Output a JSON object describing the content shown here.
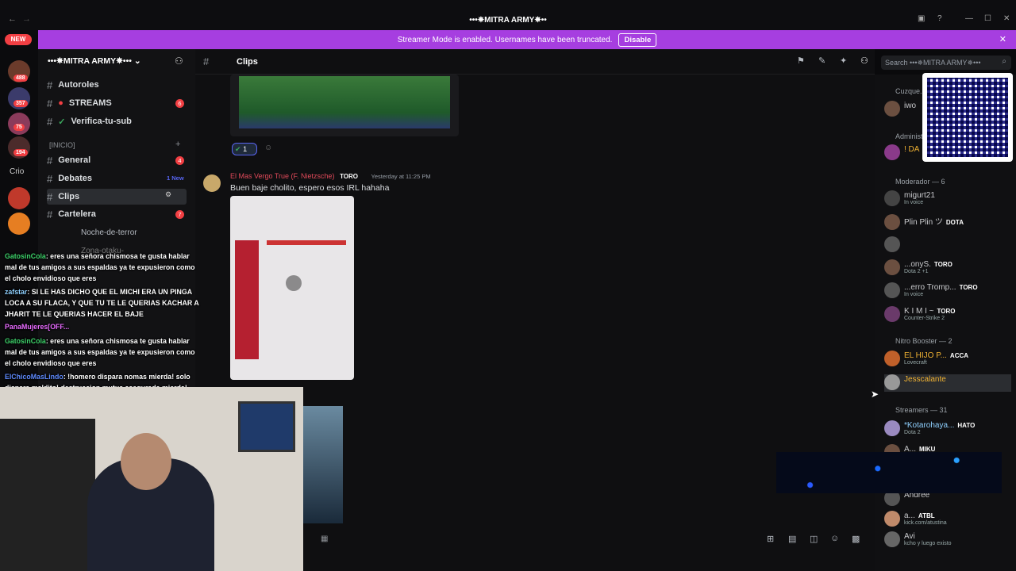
{
  "window": {
    "title": "•••✵MITRA ARMY✵••"
  },
  "banner": {
    "text": "Streamer Mode is enabled. Usernames have been truncated.",
    "button": "Disable"
  },
  "rail": {
    "new_label": "NEW",
    "pings": [
      "488",
      "357",
      "75",
      "194"
    ],
    "other": "Crio"
  },
  "server": {
    "name": "•••✵MITRA ARMY✵•••"
  },
  "channels": [
    {
      "name": "Autoroles",
      "badge": ""
    },
    {
      "name": "STREAMS",
      "badge": "6"
    },
    {
      "name": "Verifica-tu-sub",
      "badge": ""
    },
    {
      "name": "General",
      "badge": "4"
    },
    {
      "name": "Debates",
      "badge": "1 New"
    },
    {
      "name": "Clips",
      "badge": ""
    },
    {
      "name": "Cartelera",
      "badge": "7"
    },
    {
      "name": "Noche-de-terror",
      "badge": ""
    },
    {
      "name": "Zona-otaku-",
      "badge": ""
    }
  ],
  "category": "[INICIO]",
  "channel_header": {
    "name": "Clips",
    "search_placeholder": "Search •••✵MITRA ARMY✵•••"
  },
  "message": {
    "author": "El Mas Vergo True (F. Nietzsche)",
    "tag": "TORO",
    "time": "Yesterday at 11:25 PM",
    "text": "Buen baje cholito, espero esos IRL hahaha",
    "reaction_count": "1"
  },
  "chat_overlay": [
    {
      "user": "GatosinCola",
      "text": ": eres una señora chismosa te gusta hablar mal de tus amigos a sus espaldas ya te expusieron como el cholo envidioso que eres"
    },
    {
      "user": "zafstar",
      "text": ": SI LE HAS DICHO QUE EL MICHI ERA UN PINGA LOCA A SU FLACA, Y QUE TU TE LE QUERIAS KACHAR A JHARIT TE LE QUERIAS HACER EL BAJE"
    },
    {
      "user": "PanaMujeres[OFF...",
      "text": ""
    },
    {
      "user": "GatosinCola",
      "text": ": eres una señora chismosa te gusta hablar mal de tus amigos a sus espaldas ya te expusieron como el cholo envidioso que eres"
    },
    {
      "user": "ElChicoMasLindo",
      "text": ": !homero dispara nomas mierda! solo dispara maldito! destruccion mutua asegurada mierda!"
    }
  ],
  "members": {
    "sections": [
      "Cuzque...",
      "Administ...",
      "Moderador — 6",
      "Nitro Booster — 2",
      "Streamers — 31"
    ],
    "list": [
      {
        "name": "iwo",
        "status": ""
      },
      {
        "name": "! DA",
        "status": ""
      },
      {
        "name": "migurt21",
        "status": "In voice"
      },
      {
        "name": "Plin Plin ツ",
        "status": "",
        "tag": "DOTA"
      },
      {
        "name": "",
        "status": ""
      },
      {
        "name": "...onyS.",
        "status": "Dota 2 +1",
        "tag": "TORO"
      },
      {
        "name": "...erro Tromp...",
        "status": "In voice",
        "tag": "TORO"
      },
      {
        "name": "K I M I ~",
        "status": "Counter-Strike 2",
        "tag": "TORO"
      },
      {
        "name": "EL HIJO P...",
        "status": "Lovecraft",
        "tag": "ACCA"
      },
      {
        "name": "Jesscalante",
        "status": ""
      },
      {
        "name": "*Kotarohaya...",
        "status": "Dota 2",
        "tag": "HATO"
      },
      {
        "name": "A...",
        "status": "",
        "tag": "MIKU"
      },
      {
        "name": "Andree",
        "status": ""
      },
      {
        "name": "a...",
        "status": "kick.com/atustina",
        "tag": "ATBL"
      },
      {
        "name": "Avi",
        "status": "kcho y luego existo"
      }
    ]
  },
  "colors": {
    "brand": "#a63ee0",
    "ping": "#f23f43",
    "online": "#23a55a"
  }
}
